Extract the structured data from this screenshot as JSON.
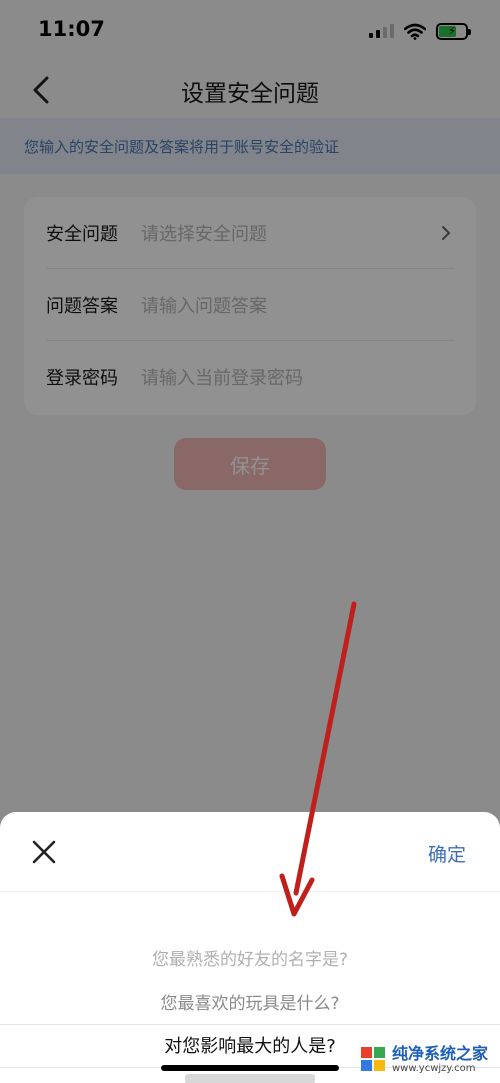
{
  "status_bar": {
    "time": "11:07",
    "icons": [
      "cellular-signal-icon",
      "wifi-icon",
      "battery-charging-icon"
    ]
  },
  "nav": {
    "title": "设置安全问题",
    "back_icon": "chevron-left-icon"
  },
  "notice": "您输入的安全问题及答案将用于账号安全的验证",
  "form": {
    "rows": [
      {
        "label": "安全问题",
        "placeholder": "请选择安全问题"
      },
      {
        "label": "问题答案",
        "placeholder": "请输入问题答案"
      },
      {
        "label": "登录密码",
        "placeholder": "请输入当前登录密码"
      }
    ]
  },
  "save_label": "保存",
  "sheet": {
    "confirm_label": "确定",
    "options": [
      "您最熟悉的好友的名字是?",
      "您最喜欢的玩具是什么?",
      "对您影响最大的人是?"
    ],
    "selected_index": 2
  },
  "watermark": {
    "title": "纯净系统之家",
    "subtitle": "www.ycwjzy.com"
  },
  "colors": {
    "accent_blue": "#3d6fb4",
    "save_button_bg": "#f5b8b8",
    "arrow_red": "#c0201c",
    "notice_bg": "#e3eaf4"
  }
}
